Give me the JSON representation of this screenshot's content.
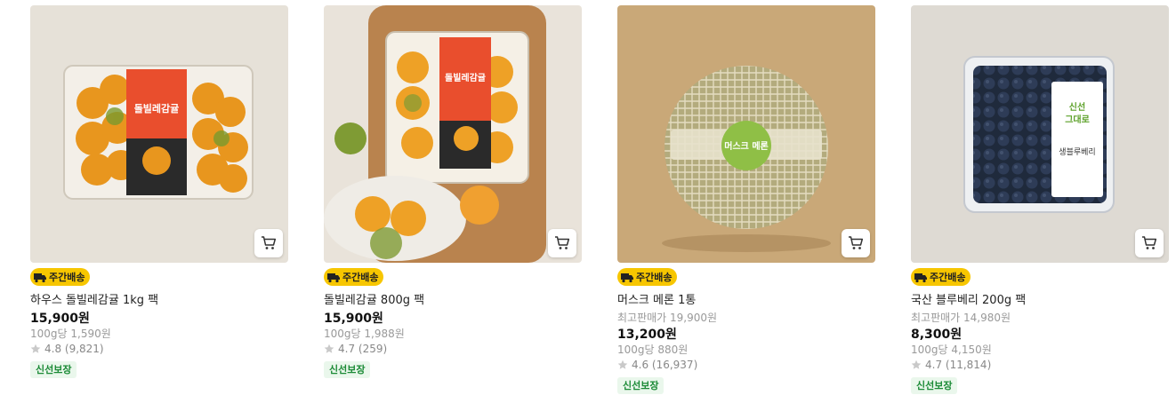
{
  "colors": {
    "badge_bg": "#f7c600",
    "tag_bg": "#eaf7ec",
    "tag_fg": "#1a8a35",
    "star": "#c9c9c9"
  },
  "products": [
    {
      "badge": "주간배송",
      "name": "하우스 돌빌레감귤 1kg 팩",
      "original_price": "",
      "price": "15,900원",
      "unit_price": "100g당 1,590원",
      "rating": "4.8 (9,821)",
      "tag": "신선보장",
      "package_label": "돌빌레감귤"
    },
    {
      "badge": "주간배송",
      "name": "돌빌레감귤 800g 팩",
      "original_price": "",
      "price": "15,900원",
      "unit_price": "100g당 1,988원",
      "rating": "4.7 (259)",
      "tag": "신선보장",
      "package_label": "돌빌레감귤"
    },
    {
      "badge": "주간배송",
      "name": "머스크 메론 1통",
      "original_price": "최고판매가 19,900원",
      "price": "13,200원",
      "unit_price": "100g당 880원",
      "rating": "4.6 (16,937)",
      "tag": "신선보장",
      "package_label": "머스크 메론"
    },
    {
      "badge": "주간배송",
      "name": "국산 블루베리 200g 팩",
      "original_price": "최고판매가 14,980원",
      "price": "8,300원",
      "unit_price": "100g당 4,150원",
      "rating": "4.7 (11,814)",
      "tag": "신선보장",
      "package_label": "생블루베리"
    }
  ],
  "icons": {
    "cart": "cart-icon",
    "truck": "truck-icon",
    "star": "star-icon"
  }
}
